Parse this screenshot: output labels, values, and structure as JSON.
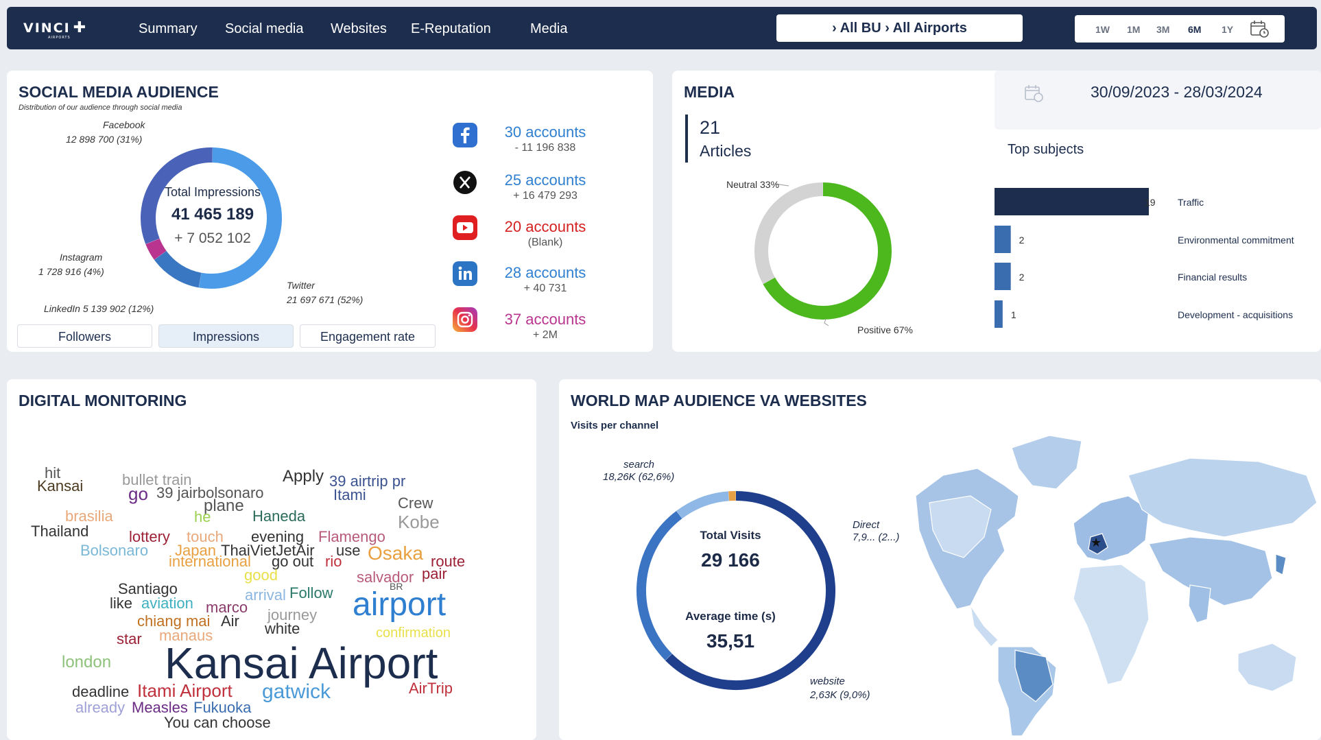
{
  "nav": {
    "logo": "VINCI",
    "logo_sub": "AIRPORTS",
    "menu": [
      "Summary",
      "Social media",
      "Websites",
      "E-Reputation",
      "Media"
    ],
    "filter": "› All BU › All Airports",
    "periods": [
      "1W",
      "1M",
      "3M",
      "6M",
      "1Y"
    ],
    "active_period": "6M"
  },
  "social": {
    "title": "SOCIAL MEDIA AUDIENCE",
    "subtitle": "Distribution of our audience through social media",
    "center_label": "Total Impressions",
    "center_value": "41 465 189",
    "center_delta": "+ 7 052 102",
    "donut": [
      {
        "name": "Twitter",
        "label": "21 697 671 (52%)",
        "value": 52,
        "color": "#4b9be8"
      },
      {
        "name": "LinkedIn",
        "label": "5 139 902 (12%)",
        "value": 12,
        "color": "#3a77c2"
      },
      {
        "name": "Instagram",
        "label": "1 728 916 (4%)",
        "value": 4,
        "color": "#b8348e"
      },
      {
        "name": "Facebook",
        "label": "12 898 700 (31%)",
        "value": 31,
        "color": "#4a63b8"
      }
    ],
    "accounts": [
      {
        "icon": "facebook-icon",
        "count": "30 accounts",
        "delta": "- 11 196 838",
        "color": "#2f7fd0"
      },
      {
        "icon": "x-icon",
        "count": "25 accounts",
        "delta": "+ 16 479 293",
        "color": "#2f7fd0"
      },
      {
        "icon": "youtube-icon",
        "count": "20 accounts",
        "delta": "(Blank)",
        "color": "#d42020"
      },
      {
        "icon": "linkedin-icon",
        "count": "28 accounts",
        "delta": "+ 40 731",
        "color": "#2f7fd0"
      },
      {
        "icon": "instagram-icon",
        "count": "37 accounts",
        "delta": "+ 2M",
        "color": "#b8348e"
      }
    ],
    "tabs": [
      "Followers",
      "Impressions",
      "Engagement rate"
    ],
    "active_tab": "Impressions"
  },
  "media": {
    "title": "MEDIA",
    "articles_count": "21",
    "articles_label": "Articles",
    "neutral_label": "Neutral 33%",
    "positive_label": "Positive 67%",
    "neutral_pct": 33,
    "positive_pct": 67,
    "date_range": "30/09/2023 - 28/03/2024",
    "top_subjects_title": "Top subjects"
  },
  "chart_data": {
    "type": "bar",
    "title": "Top subjects",
    "categories": [
      "Traffic",
      "Environmental commitment",
      "Financial results",
      "Development - acquisitions"
    ],
    "values": [
      19,
      2,
      2,
      1
    ]
  },
  "digital": {
    "title": "DIGITAL MONITORING",
    "words": [
      "hit",
      "Kansai",
      "bullet train",
      "go",
      "39 jairbolsonaro",
      "Apply",
      "39 airtrip pr",
      "Itami",
      "brasilia",
      "plane",
      "Crew",
      "he",
      "Haneda",
      "Kobe",
      "Thailand",
      "lottery",
      "touch",
      "evening",
      "Flamengo",
      "Bolsonaro",
      "Japan",
      "ThaiVietJetAir",
      "use",
      "Osaka",
      "international",
      "go out",
      "rio",
      "route",
      "good",
      "salvador",
      "pair",
      "BR",
      "Santiago",
      "Follow",
      "arrival",
      "like",
      "aviation",
      "marco",
      "airport",
      "journey",
      "chiang mai",
      "Air",
      "white",
      "confirmation",
      "star",
      "manaus",
      "Kansai Airport",
      "london",
      "deadline",
      "Itami Airport",
      "gatwick",
      "AirTrip",
      "already",
      "Measles",
      "Fukuoka",
      "You can choose"
    ]
  },
  "world": {
    "title": "WORLD MAP AUDIENCE VA WEBSITES",
    "subtitle": "Visits per channel",
    "total_label": "Total Visits",
    "total_value": "29 166",
    "avg_label": "Average time (s)",
    "avg_value": "35,51",
    "channels": [
      {
        "name": "search",
        "label": "18,26K (62,6%)",
        "value": 62.6,
        "color": "#1f3f8c"
      },
      {
        "name": "Direct",
        "label": "7,9... (2...)",
        "value": 27.2,
        "color": "#3b74c3"
      },
      {
        "name": "website",
        "label": "2,63K (9,0%)",
        "value": 9.0,
        "color": "#8fb8e6"
      },
      {
        "name": "other",
        "label": "",
        "value": 1.2,
        "color": "#e8a044"
      }
    ]
  }
}
